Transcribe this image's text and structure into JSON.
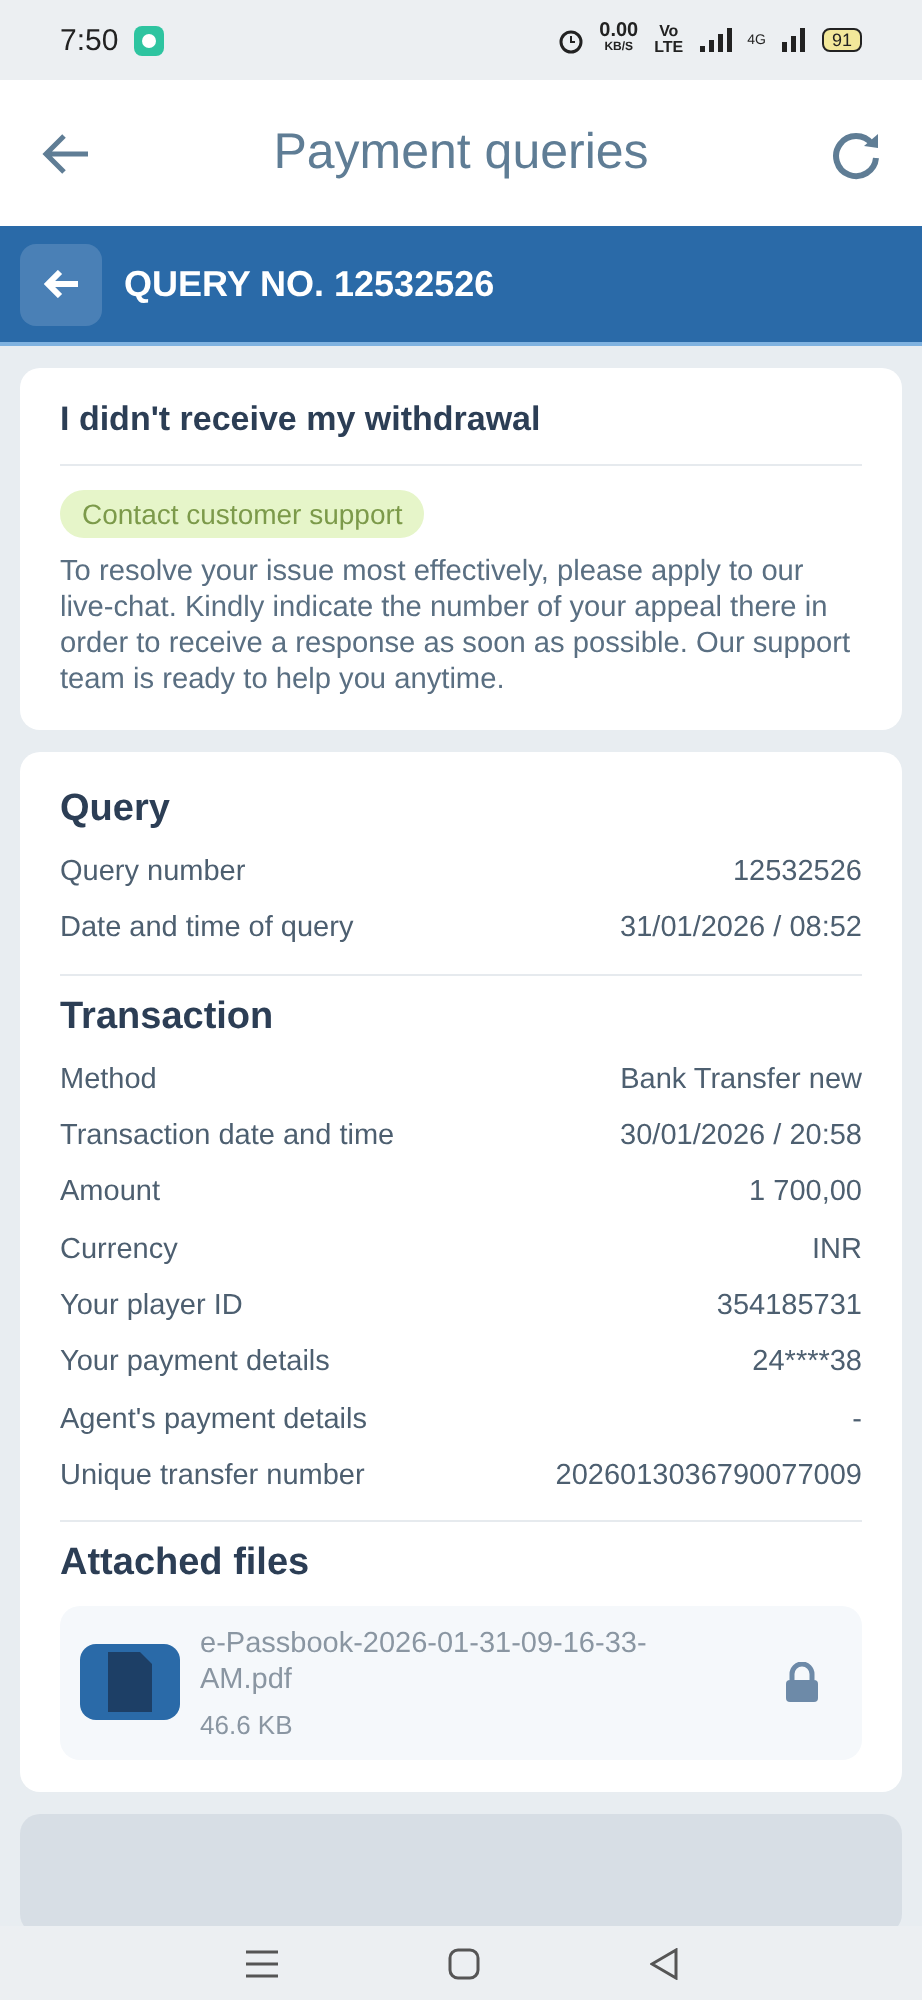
{
  "status_bar": {
    "time": "7:50",
    "speed": "0.00",
    "speed_unit": "KB/S",
    "volte_top": "Vo",
    "volte_bottom": "LTE",
    "network": "4G",
    "battery": "91"
  },
  "header": {
    "title": "Payment queries"
  },
  "query_bar": {
    "title": "QUERY NO. 12532526"
  },
  "issue": {
    "title": "I didn't receive my withdrawal",
    "badge": "Contact customer support",
    "message": "To resolve your issue most effectively, please apply to our live-chat. Kindly indicate the number of your appeal there in order to receive a response as soon as possible. Our support team is ready to help you anytime."
  },
  "sections": [
    {
      "title": "Query",
      "rows": [
        {
          "label": "Query number",
          "value": "12532526"
        },
        {
          "label": "Date and time of query",
          "value": "31/01/2026 / 08:52"
        }
      ]
    },
    {
      "title": "Transaction",
      "rows": [
        {
          "label": "Method",
          "value": "Bank Transfer new"
        },
        {
          "label": "Transaction date and time",
          "value": "30/01/2026 / 20:58"
        },
        {
          "label": "Amount",
          "value": "1 700,00"
        },
        {
          "label": "Currency",
          "value": "INR"
        },
        {
          "label": "Your player ID",
          "value": "354185731"
        },
        {
          "label": "Your payment details",
          "value": "24****38"
        },
        {
          "label": "Agent's payment details",
          "value": "-"
        },
        {
          "label": "Unique transfer number",
          "value": "2026013036790077009"
        }
      ]
    }
  ],
  "attachments": {
    "title": "Attached files",
    "files": [
      {
        "name": "e-Passbook-2026-01-31-09-16-33-AM.pdf",
        "size": "46.6 KB",
        "locked": true
      }
    ]
  }
}
